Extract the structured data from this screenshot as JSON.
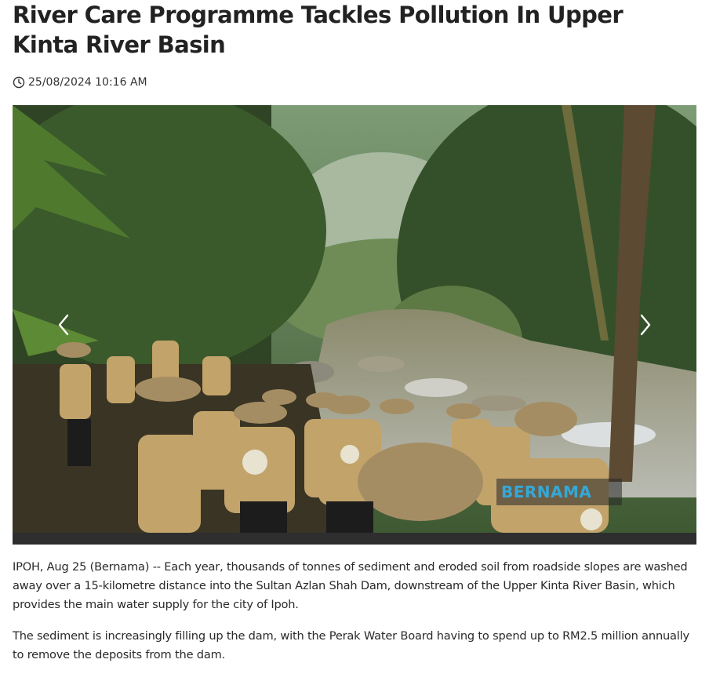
{
  "article": {
    "headline": "River Care Programme Tackles Pollution In Upper\nKinta River Basin",
    "timestamp": "25/08/2024 10:16 AM",
    "clock_icon": "clock-icon"
  },
  "gallery": {
    "watermark": "BERNAMA",
    "prev_icon": "chevron-left-icon",
    "next_icon": "chevron-right-icon"
  },
  "body": {
    "paragraphs": [
      "IPOH, Aug 25 (Bernama) -- Each year, thousands of tonnes of sediment and eroded soil from roadside slopes are washed away over a 15-kilometre distance into the Sultan Azlan Shah Dam, downstream of the Upper Kinta River Basin, which provides the main water supply for the city of Ipoh.",
      "The sediment is increasingly filling up the dam, with the Perak Water Board having to spend up to RM2.5 million annually to remove the deposits from the dam."
    ]
  },
  "colors": {
    "headline": "#222222",
    "watermark": "#35a8d8",
    "photo_bar": "#2e2e2e"
  }
}
